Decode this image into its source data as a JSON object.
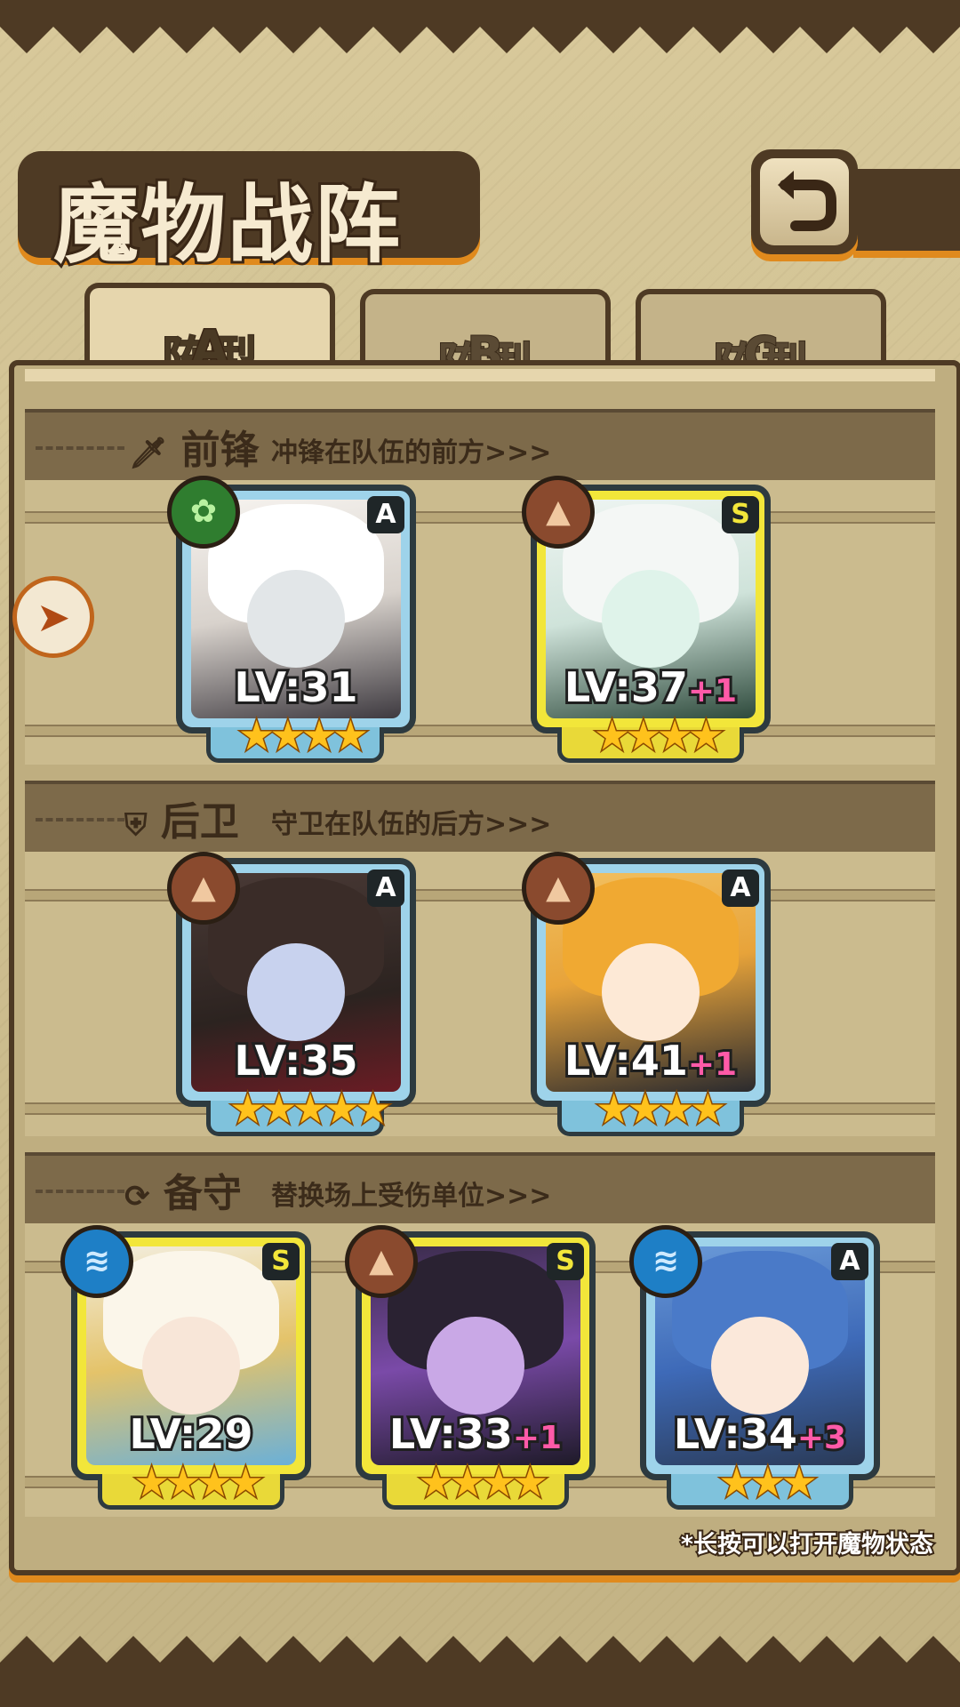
{
  "header": {
    "title": "魔物战阵"
  },
  "tabs": [
    {
      "label": "阵型",
      "suffix": "A",
      "active": true
    },
    {
      "label": "阵型",
      "suffix": "B",
      "active": false
    },
    {
      "label": "阵型",
      "suffix": "C",
      "active": false
    }
  ],
  "sections": {
    "front": {
      "title": "前锋",
      "subtitle": "冲锋在队伍的前方>>>",
      "icon": "sword-icon"
    },
    "rear": {
      "title": "后卫",
      "subtitle": "守卫在队伍的后方>>>",
      "icon": "shield-icon"
    },
    "reserve": {
      "title": "备守",
      "subtitle": "替换场上受伤单位>>>",
      "icon": "refresh-icon"
    }
  },
  "units": [
    {
      "level": "LV:31",
      "bonus": "",
      "rank": "A",
      "element": "grass-icon",
      "stars": "★★★★",
      "star_count": 4
    },
    {
      "level": "LV:37",
      "bonus": "+1",
      "rank": "S",
      "element": "rock-icon",
      "stars": "★★★★",
      "star_count": 4
    },
    {
      "level": "LV:35",
      "bonus": "",
      "rank": "A",
      "element": "rock-icon",
      "stars": "★★★★★",
      "star_count": 5
    },
    {
      "level": "LV:41",
      "bonus": "+1",
      "rank": "A",
      "element": "rock-icon",
      "stars": "★★★★",
      "star_count": 4
    },
    {
      "level": "LV:29",
      "bonus": "",
      "rank": "S",
      "element": "water-icon",
      "stars": "★★★★",
      "star_count": 4
    },
    {
      "level": "LV:33",
      "bonus": "+1",
      "rank": "S",
      "element": "rock-icon",
      "stars": "★★★★",
      "star_count": 4
    },
    {
      "level": "LV:34",
      "bonus": "+3",
      "rank": "A",
      "element": "water-icon",
      "stars": "★★★",
      "star_count": 3
    }
  ],
  "footer": {
    "hint": "*长按可以打开魔物状态"
  },
  "colors": {
    "accent": "#f2a21c",
    "frame": "#4e3a24",
    "glow": "#e08a1d",
    "rank_s": "#f2e63a",
    "rank_a": "#9ed3ea",
    "bonus": "#ff5aa8"
  }
}
